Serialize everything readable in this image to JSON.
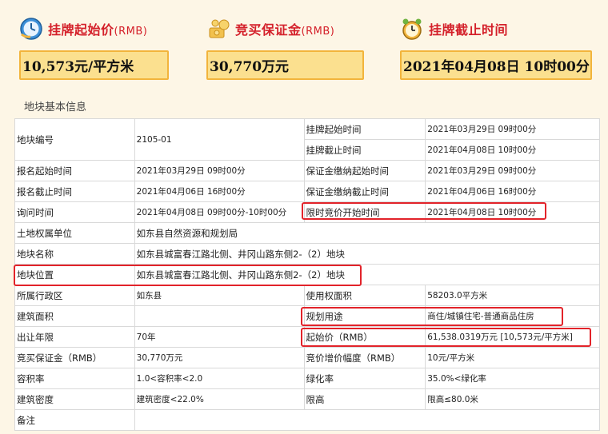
{
  "cards": [
    {
      "title": "挂牌起始价",
      "unit": "(RMB)",
      "value": "10,573元/平方米",
      "icon": "clock-icon"
    },
    {
      "title": "竞买保证金",
      "unit": "(RMB)",
      "value": "30,770万元",
      "icon": "money-icon"
    },
    {
      "title": "挂牌截止时间",
      "unit": "",
      "value": "2021年04月08日  10时00分",
      "icon": "alarm-clock-icon"
    }
  ],
  "section_title": "地块基本信息",
  "table": {
    "rows": [
      {
        "l1": "地块编号",
        "v1": "2105-01",
        "l2": "挂牌起始时间",
        "v2": "2021年03月29日 09时00分"
      },
      {
        "l2": "挂牌截止时间",
        "v2": "2021年04月08日 10时00分"
      },
      {
        "l1": "报名起始时间",
        "v1": "2021年03月29日 09时00分",
        "l2": "保证金缴纳起始时间",
        "v2": "2021年03月29日 09时00分"
      },
      {
        "l1": "报名截止时间",
        "v1": "2021年04月06日 16时00分",
        "l2": "保证金缴纳截止时间",
        "v2": "2021年04月06日 16时00分"
      },
      {
        "l1": "询问时间",
        "v1": "2021年04月08日 09时00分-10时00分",
        "l2": "限时竞价开始时间",
        "v2": "2021年04月08日 10时00分"
      },
      {
        "l1": "土地权属单位",
        "v1": "如东县自然资源和规划局"
      },
      {
        "l1": "地块名称",
        "v1": "如东县城富春江路北侧、井冈山路东侧2-（2）地块"
      },
      {
        "l1": "地块位置",
        "v1": "如东县城富春江路北侧、井冈山路东侧2-（2）地块"
      },
      {
        "l1": "所属行政区",
        "v1": "如东县",
        "l2": "使用权面积",
        "v2": "58203.0平方米"
      },
      {
        "l1": "建筑面积",
        "v1": "",
        "l2": "规划用途",
        "v2": "商住/城镇住宅-普通商品住房"
      },
      {
        "l1": "出让年限",
        "v1": "70年",
        "l2": "起始价（RMB）",
        "v2": "61,538.0319万元 [10,573元/平方米]"
      },
      {
        "l1": "竞买保证金（RMB）",
        "v1": "30,770万元",
        "l2": "竞价增价幅度（RMB）",
        "v2": "10元/平方米"
      },
      {
        "l1": "容积率",
        "v1": "1.0<容积率<2.0",
        "l2": "绿化率",
        "v2": "35.0%<绿化率"
      },
      {
        "l1": "建筑密度",
        "v1": "建筑密度<22.0%",
        "l2": "限高",
        "v2": "限高≤80.0米"
      },
      {
        "l1": "备注",
        "v1": ""
      }
    ]
  },
  "colors": {
    "accent_red": "#d4202a",
    "box_fill": "#fbe08f",
    "box_border": "#f2b43c",
    "highlight": "#e2232a"
  }
}
